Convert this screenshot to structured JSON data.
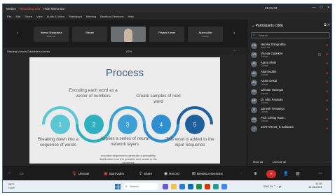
{
  "titlebar": {
    "app": "Webex",
    "recording": "Recording Info",
    "hide_menu": "Hide Menu Bar",
    "timer": "01:01:02",
    "min": "—",
    "max": "☐",
    "close": "✕"
  },
  "menu": [
    "File",
    "Edit",
    "Share",
    "View",
    "Audio & Video",
    "Participant",
    "Meeting",
    "Breakout Sessions",
    "Help"
  ],
  "gallery": {
    "tiles": [
      {
        "name": "Hamsa Shingrakha",
        "sub": "Host, me"
      },
      {
        "name": "Shivani",
        "sub": ""
      },
      {
        "name": "",
        "sub": ""
      },
      {
        "name": "Priyank Kumar",
        "sub": ""
      },
      {
        "name": "Akarmuddin",
        "sub": "Cohost"
      }
    ]
  },
  "viewbar": {
    "text": "Viewing Vrunda Gadekhe's screen",
    "zoom": "67%",
    "options": "⋯"
  },
  "slide": {
    "title": "Process",
    "texts": [
      "Encoding each word as a vector of numbers",
      "Create samples of next word",
      "Breaking down into a sequence of words",
      "Applies a series of neural network layers",
      "This word is added to the input Sequence",
      "encoded sequence to generate a probability distribution over the possible next words in the sequence"
    ],
    "circles": [
      {
        "num": "1",
        "color": "#5dc6d4"
      },
      {
        "num": "2",
        "color": "#2fb0c0"
      },
      {
        "num": "3",
        "color": "#3d9fd6"
      },
      {
        "num": "4",
        "color": "#2f8fd0"
      },
      {
        "num": "5",
        "color": "#1f5f9e"
      }
    ]
  },
  "participants": {
    "header": "Participants (166)",
    "search_placeholder": "Search",
    "list": [
      {
        "initials": "HS",
        "name": "Hamsa Shingrakha",
        "role": "Host, me"
      },
      {
        "initials": "VG",
        "name": "Vrunda Gadekhe",
        "role": "Cohost"
      },
      {
        "initials": "AS",
        "name": "Aarya Shah",
        "role": "Cohost"
      },
      {
        "initials": "AK",
        "name": "Akarmuddin",
        "role": "Cohost"
      },
      {
        "initials": "AD",
        "name": "Arpan Desai",
        "role": "Cohost"
      },
      {
        "initials": "CV",
        "name": "Chintan Vamegar",
        "role": "Cohost"
      },
      {
        "initials": "MP",
        "name": "Dr. Mitu Pauwala",
        "role": "Cohost"
      },
      {
        "initials": "JT",
        "name": "Jainesh Teraiariya",
        "role": "Cohost"
      },
      {
        "initials": "CR",
        "name": "Prof. Chirag Raun..",
        "role": "Cohost"
      },
      {
        "initials": "1",
        "name": "1570779478_K.Kalaivani",
        "role": ""
      }
    ],
    "mute_all": "Mute all",
    "unmute_all": "Unmute all"
  },
  "toolbar": {
    "unmute": "Unmute",
    "start_video": "Start video",
    "share": "Share",
    "record": "Record",
    "breakout": "Breakout sessions",
    "more": "···"
  },
  "taskbar": {
    "temp": "28°C",
    "weather": "Haze",
    "search": "Search",
    "time": "11:20",
    "date": "16-08-2023",
    "lang": "ENG IN"
  }
}
